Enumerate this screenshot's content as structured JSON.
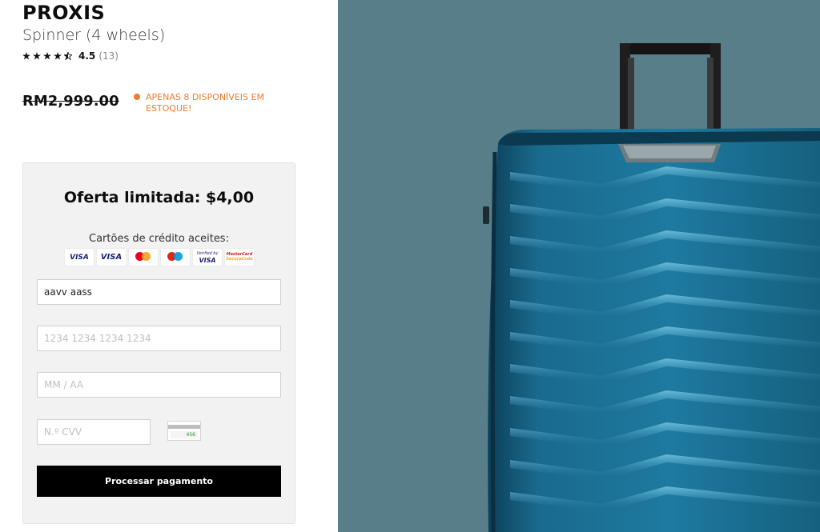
{
  "product": {
    "title": "PROXIS",
    "subtitle": "Spinner (4 wheels)",
    "rating_value": "4.5",
    "rating_count": "(13)",
    "rating_stars": 4.5,
    "price": "RM2,999.00",
    "stock_text": "APENAS 8 DISPONÍVEIS EM ESTOQUE!",
    "stock_color": "#f07a30"
  },
  "checkout": {
    "offer_title": "Oferta limitada: $4,00",
    "cards_label": "Cartões de crédito aceites:",
    "card_logos": [
      "VISA",
      "VISA",
      "mastercard-icon",
      "maestro-icon",
      "Verified by VISA",
      "MasterCard SecureCode"
    ],
    "name_value": "aavv aass",
    "card_placeholder": "1234 1234 1234 1234",
    "expiry_placeholder": "MM / AA",
    "cvv_placeholder": "N.º CVV",
    "cvv_hint_number": "456",
    "submit_label": "Processar pagamento"
  },
  "colors": {
    "background_panel": "#587f89",
    "suitcase_blue": "#1b6f93",
    "button_bg": "#000000"
  }
}
